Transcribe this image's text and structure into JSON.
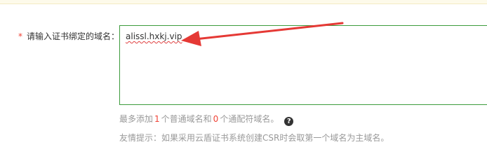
{
  "form": {
    "required_mark": "*",
    "label": "请输入证书绑定的域名：",
    "domain_value": "alissl.hxkj.vip"
  },
  "hint": {
    "prefix": "最多添加",
    "normal_count": "1",
    "middle": "个普通域名和",
    "wildcard_count": "0",
    "suffix": "个通配符域名。",
    "help_icon": "question-circle-icon"
  },
  "tip": {
    "text": "友情提示：如果采用云盾证书系统创建CSR时会取第一个域名为主域名。"
  },
  "colors": {
    "required": "#f04134",
    "textarea_border": "#3c9b3c",
    "count_highlight": "#f04134",
    "hint_text": "#999999",
    "annotation_arrow": "#e53935",
    "notice_bar": "#fdfaea"
  }
}
